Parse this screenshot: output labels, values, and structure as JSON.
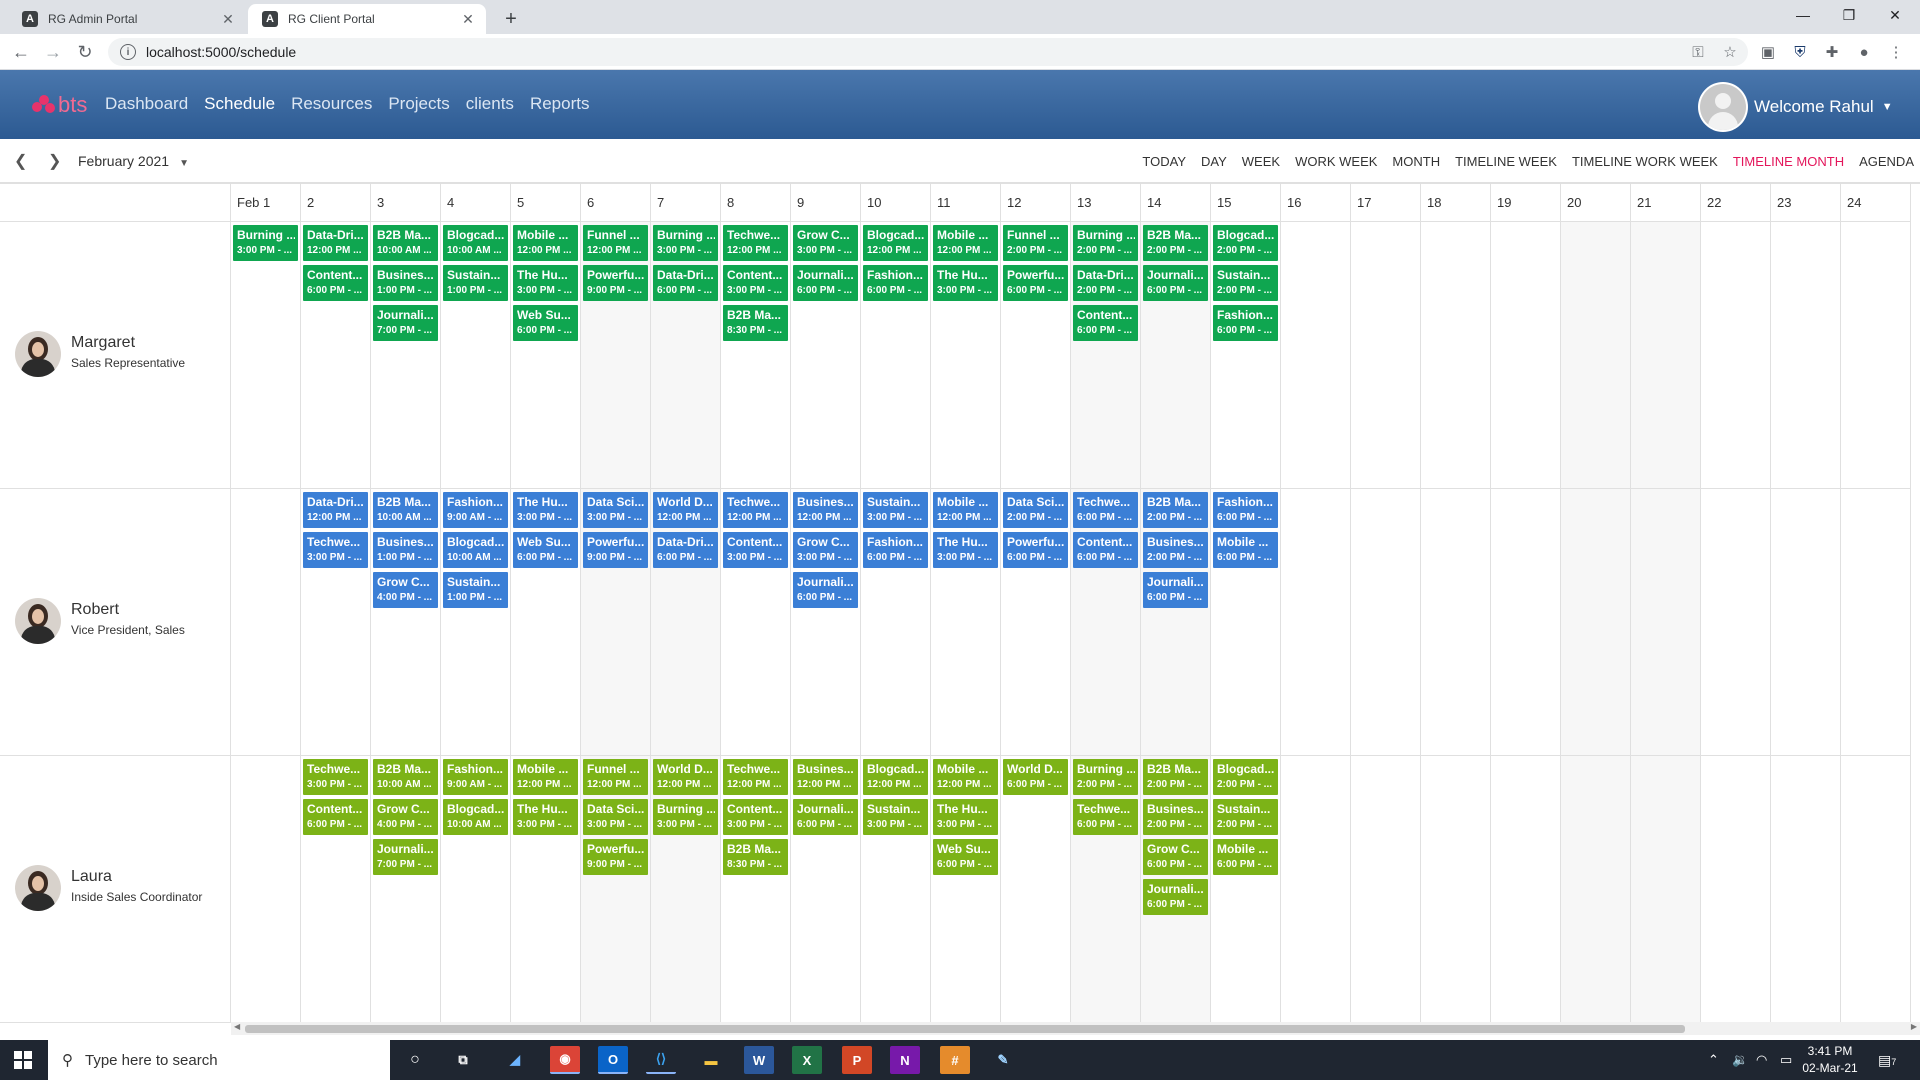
{
  "browser": {
    "tabs": [
      {
        "title": "RG Admin Portal",
        "icon": "angular-icon",
        "active": false
      },
      {
        "title": "RG Client Portal",
        "icon": "angular-icon",
        "active": true
      }
    ],
    "url": "localhost:5000/schedule"
  },
  "app": {
    "logo": "bts",
    "nav": [
      "Dashboard",
      "Schedule",
      "Resources",
      "Projects",
      "clients",
      "Reports"
    ],
    "active_nav": "Schedule",
    "welcome": "Welcome Rahul"
  },
  "scheduler": {
    "date_range": "February 2021",
    "views": [
      "TODAY",
      "DAY",
      "WEEK",
      "WORK WEEK",
      "MONTH",
      "TIMELINE WEEK",
      "TIMELINE WORK WEEK",
      "TIMELINE MONTH",
      "AGENDA"
    ],
    "active_view": "TIMELINE MONTH",
    "days": [
      "Feb 1",
      "2",
      "3",
      "4",
      "5",
      "6",
      "7",
      "8",
      "9",
      "10",
      "11",
      "12",
      "13",
      "14",
      "15",
      "16",
      "17",
      "18",
      "19",
      "20",
      "21",
      "22",
      "23",
      "24"
    ],
    "resources": [
      {
        "name": "Margaret",
        "title": "Sales Representative",
        "color": "#0fa650",
        "events": [
          {
            "day": 0,
            "slot": 0,
            "subject": "Burning ...",
            "time": "3:00 PM - ..."
          },
          {
            "day": 1,
            "slot": 0,
            "subject": "Data-Dri...",
            "time": "12:00 PM ..."
          },
          {
            "day": 1,
            "slot": 1,
            "subject": "Content...",
            "time": "6:00 PM - ..."
          },
          {
            "day": 2,
            "slot": 0,
            "subject": "B2B Ma...",
            "time": "10:00 AM ..."
          },
          {
            "day": 2,
            "slot": 1,
            "subject": "Busines...",
            "time": "1:00 PM - ..."
          },
          {
            "day": 2,
            "slot": 2,
            "subject": "Journali...",
            "time": "7:00 PM - ..."
          },
          {
            "day": 3,
            "slot": 0,
            "subject": "Blogcad...",
            "time": "10:00 AM ..."
          },
          {
            "day": 3,
            "slot": 1,
            "subject": "Sustain...",
            "time": "1:00 PM - ..."
          },
          {
            "day": 4,
            "slot": 0,
            "subject": "Mobile ...",
            "time": "12:00 PM ..."
          },
          {
            "day": 4,
            "slot": 1,
            "subject": "The Hu...",
            "time": "3:00 PM - ..."
          },
          {
            "day": 4,
            "slot": 2,
            "subject": "Web Su...",
            "time": "6:00 PM - ..."
          },
          {
            "day": 5,
            "slot": 0,
            "subject": "Funnel ...",
            "time": "12:00 PM ..."
          },
          {
            "day": 5,
            "slot": 1,
            "subject": "Powerfu...",
            "time": "9:00 PM - ..."
          },
          {
            "day": 6,
            "slot": 0,
            "subject": "Burning ...",
            "time": "3:00 PM - ..."
          },
          {
            "day": 6,
            "slot": 1,
            "subject": "Data-Dri...",
            "time": "6:00 PM - ..."
          },
          {
            "day": 7,
            "slot": 0,
            "subject": "Techwe...",
            "time": "12:00 PM ..."
          },
          {
            "day": 7,
            "slot": 1,
            "subject": "Content...",
            "time": "3:00 PM - ..."
          },
          {
            "day": 7,
            "slot": 2,
            "subject": "B2B Ma...",
            "time": "8:30 PM - ..."
          },
          {
            "day": 8,
            "slot": 0,
            "subject": "Grow C...",
            "time": "3:00 PM - ..."
          },
          {
            "day": 8,
            "slot": 1,
            "subject": "Journali...",
            "time": "6:00 PM - ..."
          },
          {
            "day": 9,
            "slot": 0,
            "subject": "Blogcad...",
            "time": "12:00 PM ..."
          },
          {
            "day": 9,
            "slot": 1,
            "subject": "Fashion...",
            "time": "6:00 PM - ..."
          },
          {
            "day": 10,
            "slot": 0,
            "subject": "Mobile ...",
            "time": "12:00 PM ..."
          },
          {
            "day": 10,
            "slot": 1,
            "subject": "The Hu...",
            "time": "3:00 PM - ..."
          },
          {
            "day": 11,
            "slot": 0,
            "subject": "Funnel ...",
            "time": "2:00 PM - ..."
          },
          {
            "day": 11,
            "slot": 1,
            "subject": "Powerfu...",
            "time": "6:00 PM - ..."
          },
          {
            "day": 12,
            "slot": 0,
            "subject": "Burning ...",
            "time": "2:00 PM - ..."
          },
          {
            "day": 12,
            "slot": 1,
            "subject": "Data-Dri...",
            "time": "2:00 PM - ..."
          },
          {
            "day": 12,
            "slot": 2,
            "subject": "Content...",
            "time": "6:00 PM - ..."
          },
          {
            "day": 13,
            "slot": 0,
            "subject": "B2B Ma...",
            "time": "2:00 PM - ..."
          },
          {
            "day": 13,
            "slot": 1,
            "subject": "Journali...",
            "time": "6:00 PM - ..."
          },
          {
            "day": 14,
            "slot": 0,
            "subject": "Blogcad...",
            "time": "2:00 PM - ..."
          },
          {
            "day": 14,
            "slot": 1,
            "subject": "Sustain...",
            "time": "2:00 PM - ..."
          },
          {
            "day": 14,
            "slot": 2,
            "subject": "Fashion...",
            "time": "6:00 PM - ..."
          }
        ]
      },
      {
        "name": "Robert",
        "title": "Vice President, Sales",
        "color": "#3b7fd6",
        "events": [
          {
            "day": 1,
            "slot": 0,
            "subject": "Data-Dri...",
            "time": "12:00 PM ..."
          },
          {
            "day": 1,
            "slot": 1,
            "subject": "Techwe...",
            "time": "3:00 PM - ..."
          },
          {
            "day": 2,
            "slot": 0,
            "subject": "B2B Ma...",
            "time": "10:00 AM ..."
          },
          {
            "day": 2,
            "slot": 1,
            "subject": "Busines...",
            "time": "1:00 PM - ..."
          },
          {
            "day": 2,
            "slot": 2,
            "subject": "Grow C...",
            "time": "4:00 PM - ..."
          },
          {
            "day": 3,
            "slot": 0,
            "subject": "Fashion...",
            "time": "9:00 AM - ..."
          },
          {
            "day": 3,
            "slot": 1,
            "subject": "Blogcad...",
            "time": "10:00 AM ..."
          },
          {
            "day": 3,
            "slot": 2,
            "subject": "Sustain...",
            "time": "1:00 PM - ..."
          },
          {
            "day": 4,
            "slot": 0,
            "subject": "The Hu...",
            "time": "3:00 PM - ..."
          },
          {
            "day": 4,
            "slot": 1,
            "subject": "Web Su...",
            "time": "6:00 PM - ..."
          },
          {
            "day": 5,
            "slot": 0,
            "subject": "Data Sci...",
            "time": "3:00 PM - ..."
          },
          {
            "day": 5,
            "slot": 1,
            "subject": "Powerfu...",
            "time": "9:00 PM - ..."
          },
          {
            "day": 6,
            "slot": 0,
            "subject": "World D...",
            "time": "12:00 PM ..."
          },
          {
            "day": 6,
            "slot": 1,
            "subject": "Data-Dri...",
            "time": "6:00 PM - ..."
          },
          {
            "day": 7,
            "slot": 0,
            "subject": "Techwe...",
            "time": "12:00 PM ..."
          },
          {
            "day": 7,
            "slot": 1,
            "subject": "Content...",
            "time": "3:00 PM - ..."
          },
          {
            "day": 8,
            "slot": 0,
            "subject": "Busines...",
            "time": "12:00 PM ..."
          },
          {
            "day": 8,
            "slot": 1,
            "subject": "Grow C...",
            "time": "3:00 PM - ..."
          },
          {
            "day": 8,
            "slot": 2,
            "subject": "Journali...",
            "time": "6:00 PM - ..."
          },
          {
            "day": 9,
            "slot": 0,
            "subject": "Sustain...",
            "time": "3:00 PM - ..."
          },
          {
            "day": 9,
            "slot": 1,
            "subject": "Fashion...",
            "time": "6:00 PM - ..."
          },
          {
            "day": 10,
            "slot": 0,
            "subject": "Mobile ...",
            "time": "12:00 PM ..."
          },
          {
            "day": 10,
            "slot": 1,
            "subject": "The Hu...",
            "time": "3:00 PM - ..."
          },
          {
            "day": 11,
            "slot": 0,
            "subject": "Data Sci...",
            "time": "2:00 PM - ..."
          },
          {
            "day": 11,
            "slot": 1,
            "subject": "Powerfu...",
            "time": "6:00 PM - ..."
          },
          {
            "day": 12,
            "slot": 0,
            "subject": "Techwe...",
            "time": "6:00 PM - ..."
          },
          {
            "day": 12,
            "slot": 1,
            "subject": "Content...",
            "time": "6:00 PM - ..."
          },
          {
            "day": 13,
            "slot": 0,
            "subject": "B2B Ma...",
            "time": "2:00 PM - ..."
          },
          {
            "day": 13,
            "slot": 1,
            "subject": "Busines...",
            "time": "2:00 PM - ..."
          },
          {
            "day": 13,
            "slot": 2,
            "subject": "Journali...",
            "time": "6:00 PM - ..."
          },
          {
            "day": 14,
            "slot": 0,
            "subject": "Fashion...",
            "time": "6:00 PM - ..."
          },
          {
            "day": 14,
            "slot": 1,
            "subject": "Mobile ...",
            "time": "6:00 PM - ..."
          }
        ]
      },
      {
        "name": "Laura",
        "title": "Inside Sales Coordinator",
        "color": "#7cb317",
        "events": [
          {
            "day": 1,
            "slot": 0,
            "subject": "Techwe...",
            "time": "3:00 PM - ..."
          },
          {
            "day": 1,
            "slot": 1,
            "subject": "Content...",
            "time": "6:00 PM - ..."
          },
          {
            "day": 2,
            "slot": 0,
            "subject": "B2B Ma...",
            "time": "10:00 AM ..."
          },
          {
            "day": 2,
            "slot": 1,
            "subject": "Grow C...",
            "time": "4:00 PM - ..."
          },
          {
            "day": 2,
            "slot": 2,
            "subject": "Journali...",
            "time": "7:00 PM - ..."
          },
          {
            "day": 3,
            "slot": 0,
            "subject": "Fashion...",
            "time": "9:00 AM - ..."
          },
          {
            "day": 3,
            "slot": 1,
            "subject": "Blogcad...",
            "time": "10:00 AM ..."
          },
          {
            "day": 4,
            "slot": 0,
            "subject": "Mobile ...",
            "time": "12:00 PM ..."
          },
          {
            "day": 4,
            "slot": 1,
            "subject": "The Hu...",
            "time": "3:00 PM - ..."
          },
          {
            "day": 5,
            "slot": 0,
            "subject": "Funnel ...",
            "time": "12:00 PM ..."
          },
          {
            "day": 5,
            "slot": 1,
            "subject": "Data Sci...",
            "time": "3:00 PM - ..."
          },
          {
            "day": 5,
            "slot": 2,
            "subject": "Powerfu...",
            "time": "9:00 PM - ..."
          },
          {
            "day": 6,
            "slot": 0,
            "subject": "World D...",
            "time": "12:00 PM ..."
          },
          {
            "day": 6,
            "slot": 1,
            "subject": "Burning ...",
            "time": "3:00 PM - ..."
          },
          {
            "day": 7,
            "slot": 0,
            "subject": "Techwe...",
            "time": "12:00 PM ..."
          },
          {
            "day": 7,
            "slot": 1,
            "subject": "Content...",
            "time": "3:00 PM - ..."
          },
          {
            "day": 7,
            "slot": 2,
            "subject": "B2B Ma...",
            "time": "8:30 PM - ..."
          },
          {
            "day": 8,
            "slot": 0,
            "subject": "Busines...",
            "time": "12:00 PM ..."
          },
          {
            "day": 8,
            "slot": 1,
            "subject": "Journali...",
            "time": "6:00 PM - ..."
          },
          {
            "day": 9,
            "slot": 0,
            "subject": "Blogcad...",
            "time": "12:00 PM ..."
          },
          {
            "day": 9,
            "slot": 1,
            "subject": "Sustain...",
            "time": "3:00 PM - ..."
          },
          {
            "day": 10,
            "slot": 0,
            "subject": "Mobile ...",
            "time": "12:00 PM ..."
          },
          {
            "day": 10,
            "slot": 1,
            "subject": "The Hu...",
            "time": "3:00 PM - ..."
          },
          {
            "day": 10,
            "slot": 2,
            "subject": "Web Su...",
            "time": "6:00 PM - ..."
          },
          {
            "day": 11,
            "slot": 0,
            "subject": "World D...",
            "time": "6:00 PM - ..."
          },
          {
            "day": 12,
            "slot": 0,
            "subject": "Burning ...",
            "time": "2:00 PM - ..."
          },
          {
            "day": 12,
            "slot": 1,
            "subject": "Techwe...",
            "time": "6:00 PM - ..."
          },
          {
            "day": 13,
            "slot": 0,
            "subject": "B2B Ma...",
            "time": "2:00 PM - ..."
          },
          {
            "day": 13,
            "slot": 1,
            "subject": "Busines...",
            "time": "2:00 PM - ..."
          },
          {
            "day": 13,
            "slot": 2,
            "subject": "Grow C...",
            "time": "6:00 PM - ..."
          },
          {
            "day": 13,
            "slot": 3,
            "subject": "Journali...",
            "time": "6:00 PM - ..."
          },
          {
            "day": 14,
            "slot": 0,
            "subject": "Blogcad...",
            "time": "2:00 PM - ..."
          },
          {
            "day": 14,
            "slot": 1,
            "subject": "Sustain...",
            "time": "2:00 PM - ..."
          },
          {
            "day": 14,
            "slot": 2,
            "subject": "Mobile ...",
            "time": "6:00 PM - ..."
          }
        ]
      }
    ]
  },
  "taskbar": {
    "search_placeholder": "Type here to search",
    "time": "3:41 PM",
    "date": "02-Mar-21",
    "notification_count": "7"
  }
}
